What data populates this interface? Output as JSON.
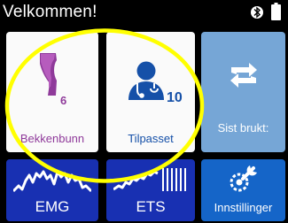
{
  "header": {
    "title": "Velkommen!",
    "bluetooth_icon": "bluetooth-icon",
    "battery_icon": "battery-icon"
  },
  "tiles": {
    "bekkenbunn": {
      "label": "Bekkenbunn",
      "count": "6",
      "icon": "pelvis-icon"
    },
    "tilpasset": {
      "label": "Tilpasset",
      "count": "10",
      "icon": "user-doctor-icon"
    },
    "sist_brukt": {
      "label": "Sist brukt:",
      "icon": "repeat-icon"
    },
    "emg": {
      "label": "EMG",
      "icon": "emg-wave-icon"
    },
    "ets": {
      "label": "ETS",
      "icon": "ets-wave-icon"
    },
    "innstillinger": {
      "label": "Innstillinger",
      "icon": "settings-wrench-icon"
    }
  },
  "colors": {
    "background": "#000000",
    "tile_light": "#fafafa",
    "tile_dark_blue": "#1830b2",
    "tile_light_blue": "#76a6d6",
    "tile_settings_blue": "#1565c8",
    "purple": "#8f3a9a",
    "blue_text": "#1550a8",
    "highlight_yellow": "#ffff00"
  }
}
